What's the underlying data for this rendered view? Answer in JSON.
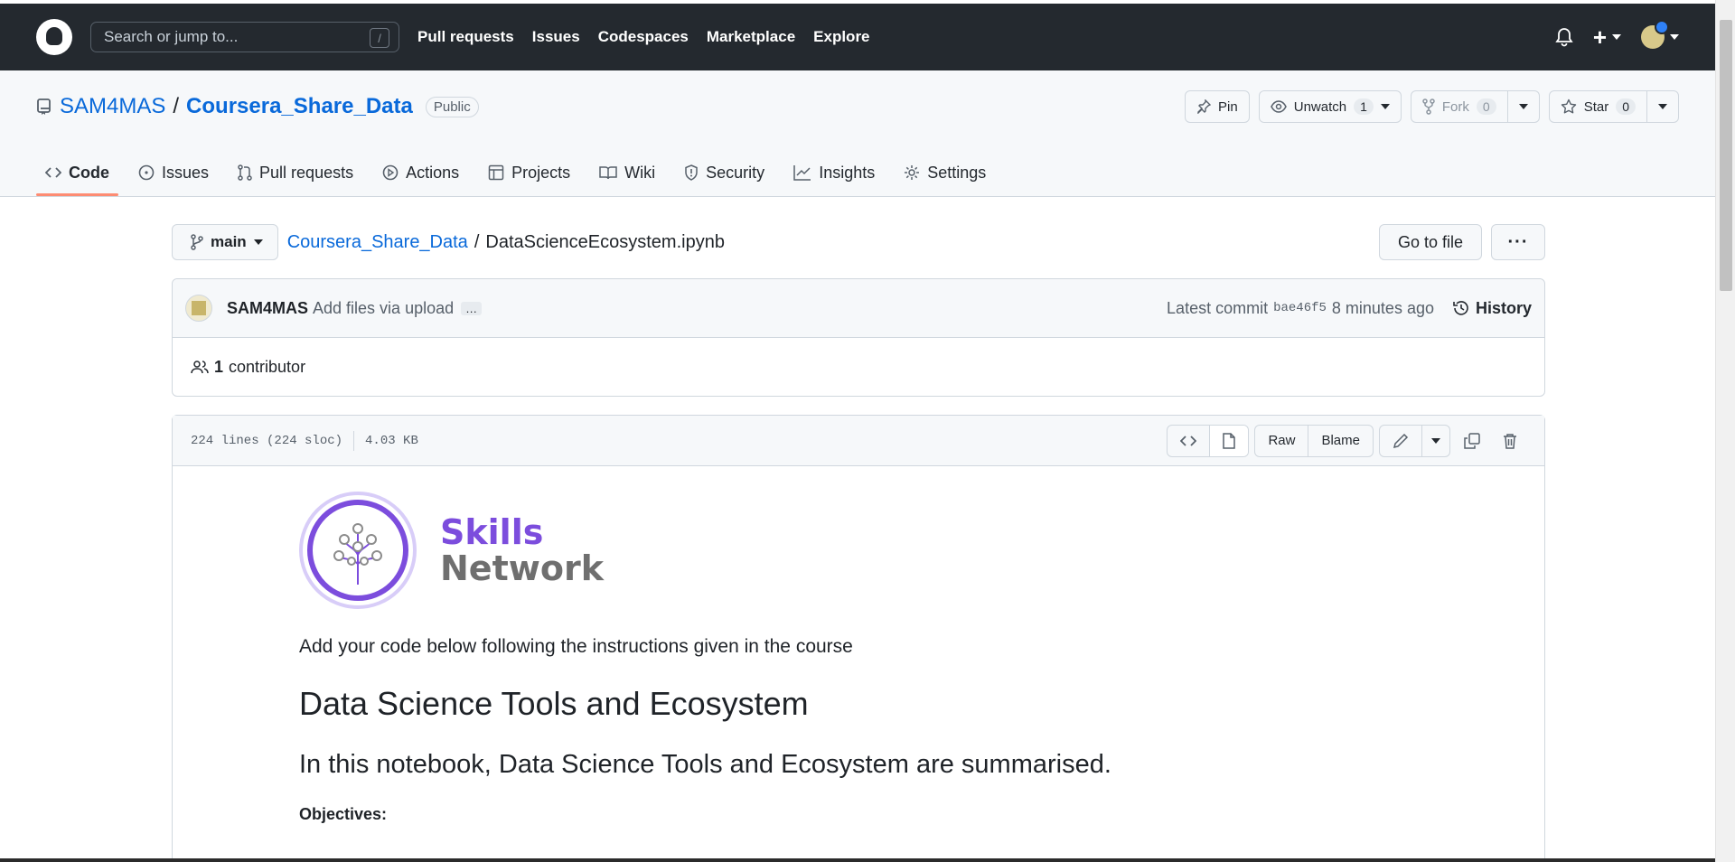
{
  "header": {
    "search_placeholder": "Search or jump to...",
    "search_shortcut": "/",
    "nav": [
      "Pull requests",
      "Issues",
      "Codespaces",
      "Marketplace",
      "Explore"
    ]
  },
  "repo": {
    "owner": "SAM4MAS",
    "separator": "/",
    "name": "Coursera_Share_Data",
    "visibility": "Public",
    "pin_label": "Pin",
    "unwatch_label": "Unwatch",
    "unwatch_count": "1",
    "fork_label": "Fork",
    "fork_count": "0",
    "star_label": "Star",
    "star_count": "0"
  },
  "tabs": [
    {
      "label": "Code",
      "icon": "code-icon"
    },
    {
      "label": "Issues",
      "icon": "issue-icon"
    },
    {
      "label": "Pull requests",
      "icon": "pull-request-icon"
    },
    {
      "label": "Actions",
      "icon": "play-icon"
    },
    {
      "label": "Projects",
      "icon": "table-icon"
    },
    {
      "label": "Wiki",
      "icon": "book-icon"
    },
    {
      "label": "Security",
      "icon": "shield-icon"
    },
    {
      "label": "Insights",
      "icon": "graph-icon"
    },
    {
      "label": "Settings",
      "icon": "gear-icon"
    }
  ],
  "path": {
    "branch": "main",
    "repo_link": "Coursera_Share_Data",
    "separator": "/",
    "file": "DataScienceEcosystem.ipynb",
    "go_to_file": "Go to file",
    "more": "···"
  },
  "commit": {
    "author": "SAM4MAS",
    "message": "Add files via upload",
    "ellipsis": "…",
    "latest_label": "Latest commit",
    "sha": "bae46f5",
    "time": "8 minutes ago",
    "history": "History",
    "contributor_count": "1",
    "contributor_label": "contributor"
  },
  "file": {
    "lines": "224 lines (224 sloc)",
    "size": "4.03 KB",
    "raw": "Raw",
    "blame": "Blame"
  },
  "notebook": {
    "logo_word1": "Skills",
    "logo_word2": "Network",
    "intro": "Add your code below following the instructions given in the course",
    "h1": "Data Science Tools and Ecosystem",
    "h2": "In this notebook, Data Science Tools and Ecosystem are summarised.",
    "objectives": "Objectives:"
  },
  "colors": {
    "header_bg": "#24292f",
    "link": "#0969da",
    "active_tab_underline": "#fd8c73",
    "skills_purple": "#7c4ddd",
    "network_gray": "#6f6f6f"
  }
}
